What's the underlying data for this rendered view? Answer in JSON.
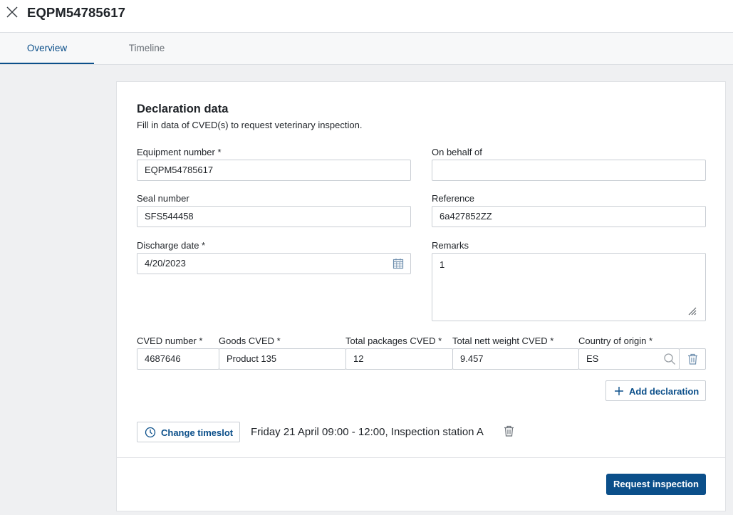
{
  "header": {
    "title": "EQPM54785617",
    "close_icon": "close-icon"
  },
  "tabs": [
    {
      "label": "Overview",
      "active": true
    },
    {
      "label": "Timeline",
      "active": false
    }
  ],
  "form": {
    "title": "Declaration data",
    "subtitle": "Fill in data of CVED(s) to request veterinary inspection.",
    "equipment_number": {
      "label": "Equipment number *",
      "value": "EQPM54785617"
    },
    "on_behalf_of": {
      "label": "On behalf of",
      "value": ""
    },
    "seal_number": {
      "label": "Seal number",
      "value": "SFS544458"
    },
    "reference": {
      "label": "Reference",
      "value": "6a427852ZZ"
    },
    "discharge_date": {
      "label": "Discharge date *",
      "value": "4/20/2023",
      "icon": "calendar-icon"
    },
    "remarks": {
      "label": "Remarks",
      "value": "1",
      "icon": "resize-handle-icon"
    }
  },
  "cved": {
    "headers": {
      "cved_number": "CVED number *",
      "goods": "Goods CVED *",
      "packages": "Total packages CVED *",
      "weight": "Total nett weight CVED *",
      "country": "Country of origin *"
    },
    "row": {
      "cved_number": "4687646",
      "goods": "Product 135",
      "packages": "12",
      "weight": "9.457",
      "country": "ES"
    },
    "search_icon": "search-icon",
    "delete_icon": "trash-icon",
    "add_label": "Add declaration"
  },
  "timeslot": {
    "button_label": "Change timeslot",
    "text": "Friday 21 April 09:00 - 12:00, Inspection station A",
    "clock_icon": "clock-icon",
    "delete_icon": "trash-icon"
  },
  "actions": {
    "request_label": "Request inspection"
  },
  "colors": {
    "accent": "#0b4f8a",
    "background": "#eff0f2",
    "border": "#c9ced4"
  }
}
